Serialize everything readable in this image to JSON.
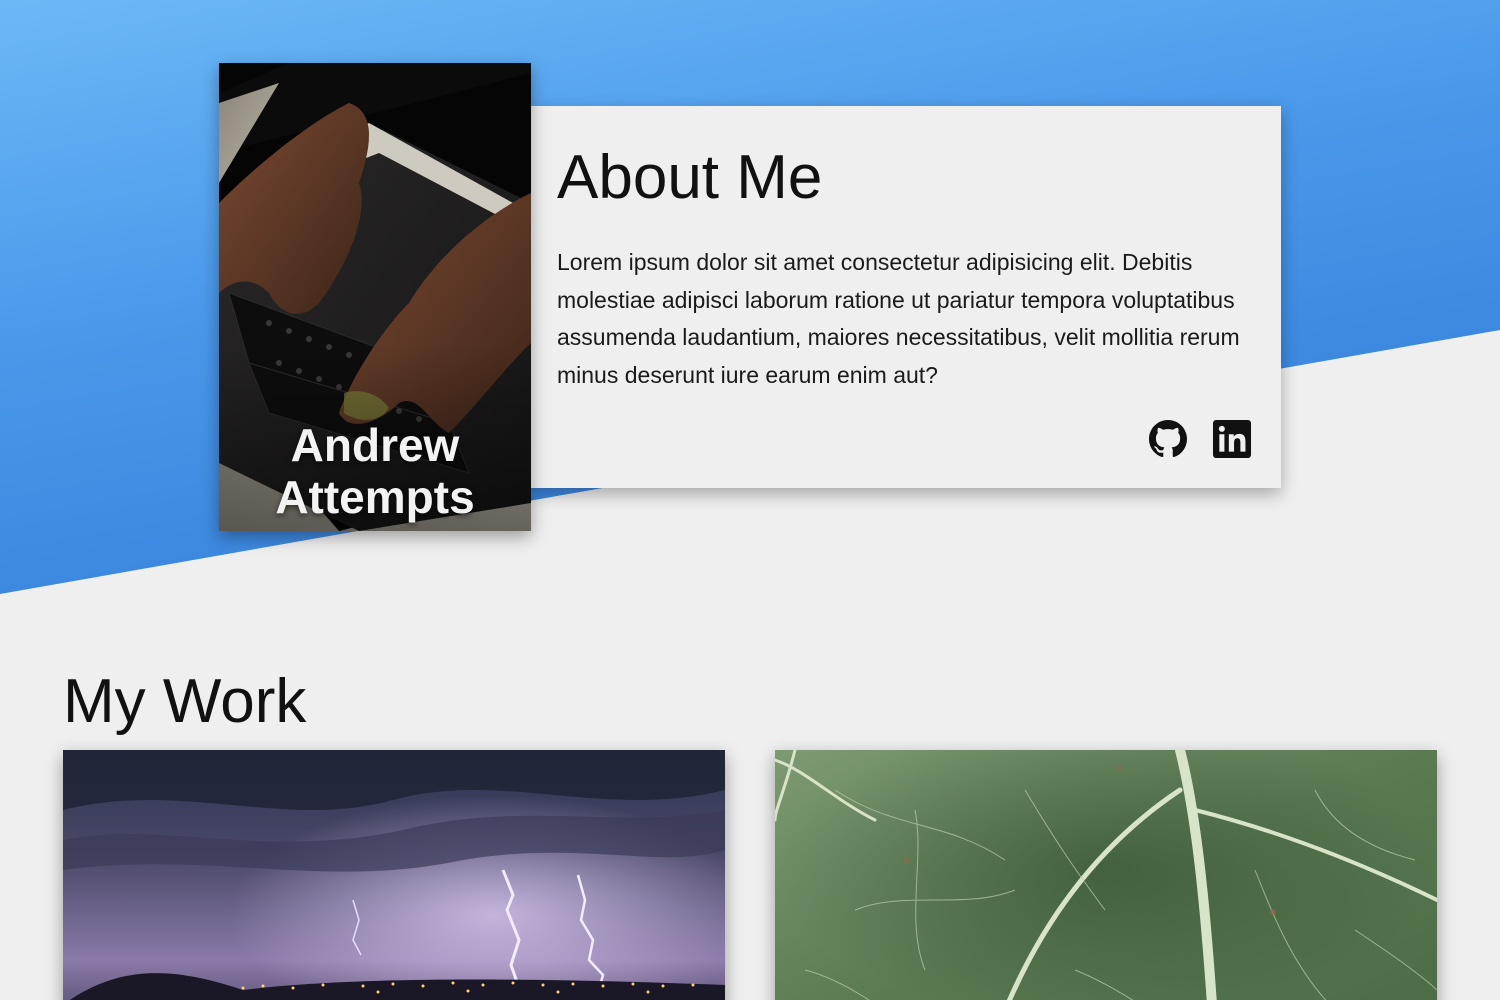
{
  "profile": {
    "name_line1": "Andrew",
    "name_line2": "Attempts",
    "image_icon": "hands-typing-laptop-photo"
  },
  "about": {
    "title": "About Me",
    "text": "Lorem ipsum dolor sit amet consectetur adipisicing elit. Debitis molestiae adipisci laborum ratione ut pariatur tempora voluptatibus assumenda laudantium, maiores necessitatibus, velit mollitia rerum minus deserunt iure earum enim aut?",
    "social": [
      {
        "icon": "github-icon"
      },
      {
        "icon": "linkedin-icon"
      }
    ]
  },
  "work": {
    "title": "My Work",
    "projects": [
      {
        "image": "lightning-storm-city-photo"
      },
      {
        "image": "green-leaf-closeup-photo"
      }
    ]
  },
  "colors": {
    "hero_blue_light": "#6cb8f7",
    "hero_blue_dark": "#2f78d6",
    "page_bg": "#efefef",
    "text": "#111111"
  }
}
